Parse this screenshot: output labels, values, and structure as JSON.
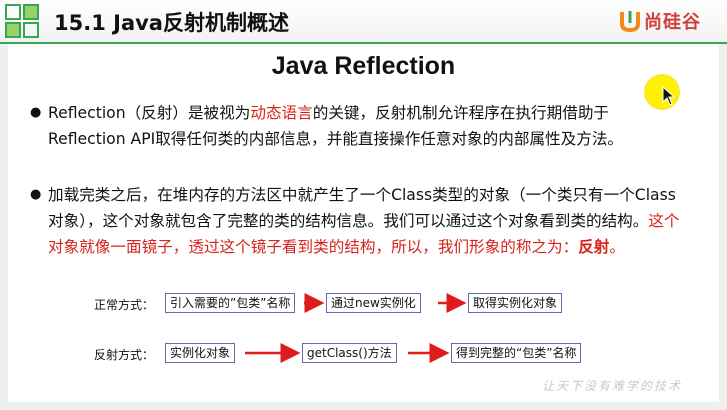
{
  "header": {
    "title": "15.1 Java反射机制概述",
    "brand_name": "尚硅谷",
    "brand_color": "#d3403c",
    "accent_color": "#3aa655"
  },
  "slide": {
    "title": "Java Reflection",
    "paragraph1": {
      "part1": "Reflection（反射）是被视为",
      "highlight": "动态语言",
      "part2": "的关键，反射机制允许程序在执行期借助于Reflection API取得任何类的内部信息，并能直接操作任意对象的内部属性及方法。"
    },
    "paragraph2": {
      "part1": "加载完类之后，在堆内存的方法区中就产生了一个Class类型的对象（一个类只有一个Class对象），这个对象就包含了完整的类的结构信息。我们可以通过这个对象看到类的结构。",
      "highlight": "这个对象就像一面镜子，透过这个镜子看到类的结构，所以，我们形象的称之为：",
      "highlight_bold": "反射",
      "end": "。"
    },
    "highlight_color": "#d8231c",
    "normal_flow": {
      "label": "正常方式：",
      "steps": [
        "引入需要的”包类”名称",
        "通过new实例化",
        "取得实例化对象"
      ]
    },
    "reflection_flow": {
      "label": "反射方式：",
      "steps": [
        "实例化对象",
        "getClass()方法",
        "得到完整的“包类”名称"
      ]
    },
    "motto": "让天下没有难学的技术"
  },
  "icons": [
    "logo-squares-icon",
    "brand-logo-icon",
    "bullet-icon",
    "arrow-icon",
    "mouse-cursor-icon",
    "pointer-highlight-icon"
  ]
}
